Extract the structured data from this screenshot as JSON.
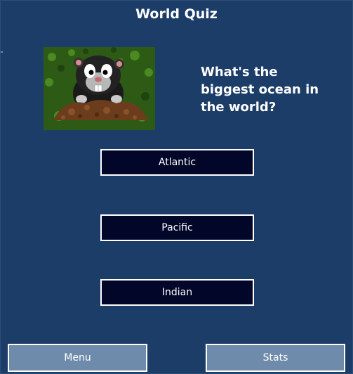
{
  "app": {
    "title": "World Quiz"
  },
  "mascot": {
    "icon": "mole-mascot-icon"
  },
  "question": {
    "text": "What's the biggest ocean in the world?"
  },
  "answers": [
    {
      "label": "Atlantic"
    },
    {
      "label": "Pacific"
    },
    {
      "label": "Indian"
    }
  ],
  "nav": {
    "menu_label": "Menu",
    "stats_label": "Stats"
  },
  "colors": {
    "background": "#1b3d68",
    "answer_button": "#020628",
    "nav_button": "#6f8bab",
    "text": "#ffffff"
  }
}
